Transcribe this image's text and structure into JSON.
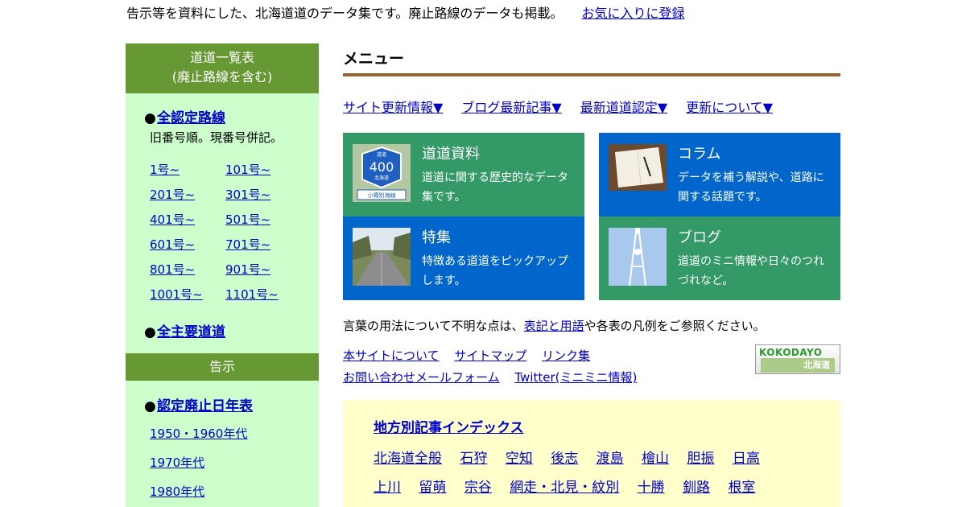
{
  "header": {
    "intro": "告示等を資料にした、北海道道のデータ集です。廃止路線のデータも掲載。",
    "favorite_link": "お気に入りに登録"
  },
  "sidebar": {
    "heading1_line1": "道道一覧表",
    "heading1_line2": "(廃止路線を含む)",
    "all_routes": "全認定路線",
    "note": "旧番号順。現番号併記。",
    "route_ranges": [
      "1号~",
      "101号~",
      "201号~",
      "301号~",
      "401号~",
      "501号~",
      "601号~",
      "701号~",
      "801号~",
      "901号~",
      "1001号~",
      "1101号~"
    ],
    "main_roads": "全主要道道",
    "heading2": "告示",
    "abolition_table": "認定廃止日年表",
    "eras": [
      "1950・1960年代",
      "1970年代",
      "1980年代"
    ]
  },
  "main": {
    "title": "メニュー",
    "quick_links": [
      "サイト更新情報▼",
      "ブログ最新記事▼",
      "最新道道認定▼",
      "更新について▼"
    ],
    "tiles": [
      {
        "title": "道道資料",
        "desc": "道道に関する歴史的なデータ集です。",
        "sign_text": "400",
        "sign_top": "道道",
        "sign_bottom": "北海道",
        "sign_plate": "小樽別海線"
      },
      {
        "title": "コラム",
        "desc": "データを補う解説や、道路に関する話題です。"
      },
      {
        "title": "特集",
        "desc": "特徴ある道道をピックアップします。"
      },
      {
        "title": "ブログ",
        "desc": "道道のミニ情報や日々のつれづれなど。"
      }
    ],
    "notice_prefix": "言葉の用法について不明な点は、",
    "notice_link": "表記と用語",
    "notice_suffix": "や各表の凡例をご参照ください。",
    "site_links_row1": [
      "本サイトについて",
      "サイトマップ",
      "リンク集"
    ],
    "site_links_row2": [
      "お問い合わせメールフォーム",
      "Twitter(ミニミニ情報)"
    ],
    "banner": {
      "line1": "KOKODAYO",
      "line2": "北海道"
    },
    "regional": {
      "title": "地方別記事インデックス",
      "row1": [
        "北海道全般",
        "石狩",
        "空知",
        "後志",
        "渡島",
        "檜山",
        "胆振",
        "日高"
      ],
      "row2": [
        "上川",
        "留萌",
        "宗谷",
        "網走・北見・紋別",
        "十勝",
        "釧路",
        "根室"
      ]
    }
  },
  "colors": {
    "sidebar_header": "#669933",
    "sidebar_bg": "#ccffcc",
    "tile_green": "#339966",
    "tile_blue": "#0066cc",
    "rule": "#996633",
    "regional_bg": "#ffffcc",
    "link": "#0000cc"
  }
}
